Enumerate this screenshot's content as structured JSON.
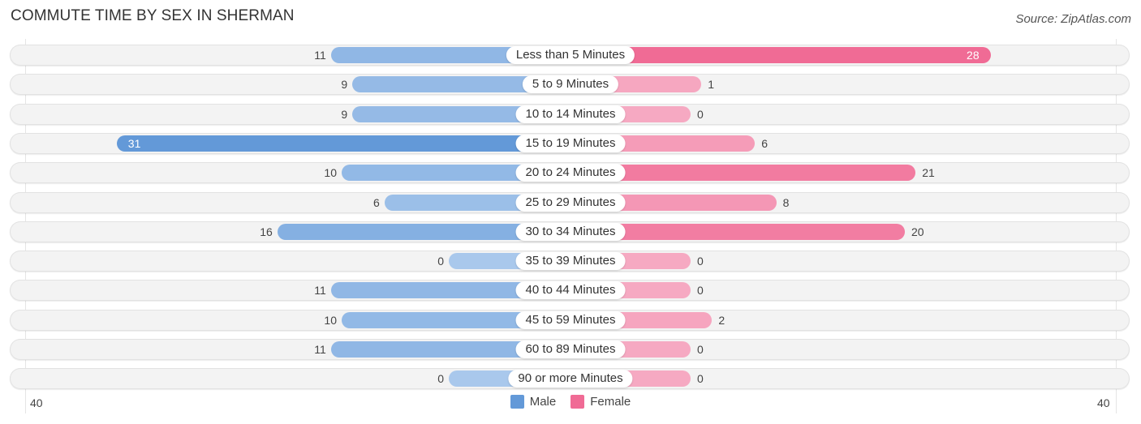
{
  "header": {
    "title": "COMMUTE TIME BY SEX IN SHERMAN",
    "source": "Source: ZipAtlas.com"
  },
  "colors": {
    "male_strong": "#6399d8",
    "male_light": "#a9c8ec",
    "female_strong": "#f06b95",
    "female_light": "#f6a9c2",
    "row_bg": "#f3f3f3"
  },
  "legend": {
    "male": "Male",
    "female": "Female"
  },
  "axis": {
    "left_label": "40",
    "right_label": "40"
  },
  "chart_data": {
    "type": "bar",
    "orientation": "horizontal-diverging",
    "title": "COMMUTE TIME BY SEX IN SHERMAN",
    "xlabel": "",
    "ylabel": "",
    "xlim": [
      -40,
      40
    ],
    "legend_position": "bottom-center",
    "categories": [
      "Less than 5 Minutes",
      "5 to 9 Minutes",
      "10 to 14 Minutes",
      "15 to 19 Minutes",
      "20 to 24 Minutes",
      "25 to 29 Minutes",
      "30 to 34 Minutes",
      "35 to 39 Minutes",
      "40 to 44 Minutes",
      "45 to 59 Minutes",
      "60 to 89 Minutes",
      "90 or more Minutes"
    ],
    "series": [
      {
        "name": "Male",
        "values": [
          11,
          9,
          9,
          31,
          10,
          6,
          16,
          0,
          11,
          10,
          11,
          0
        ]
      },
      {
        "name": "Female",
        "values": [
          28,
          1,
          0,
          6,
          21,
          8,
          20,
          0,
          0,
          2,
          0,
          0
        ]
      }
    ]
  }
}
